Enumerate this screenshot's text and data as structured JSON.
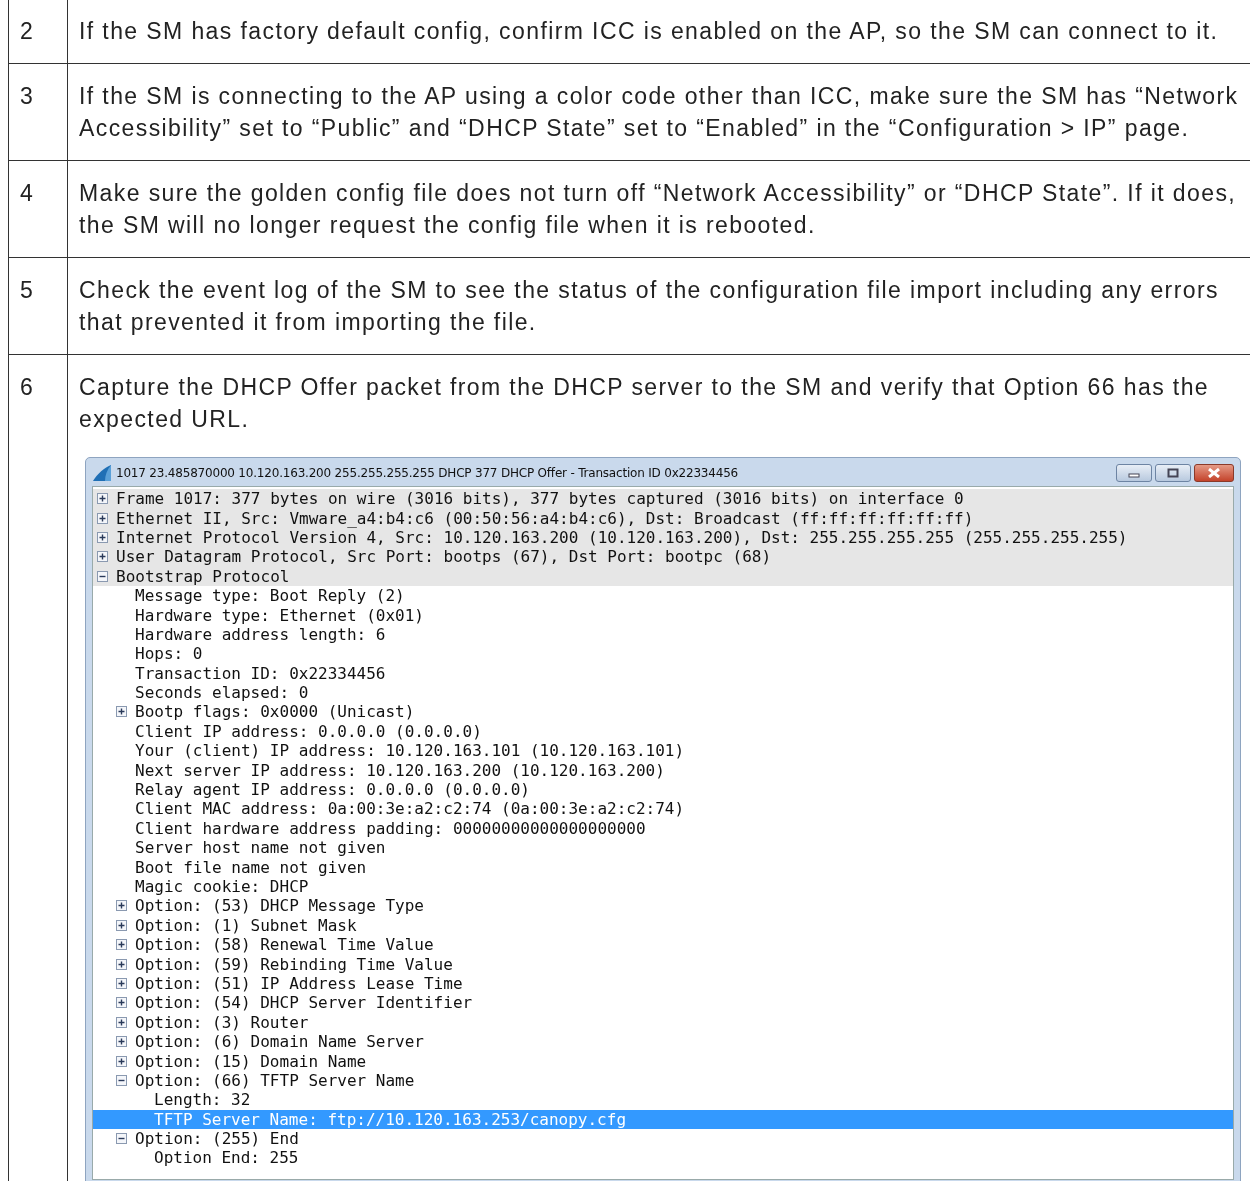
{
  "steps": [
    {
      "number": "2",
      "text": "If the SM has factory default config, confirm ICC is enabled on the AP, so the SM can connect to it."
    },
    {
      "number": "3",
      "text": "If the SM is connecting to the AP using a color code other than ICC, make sure the SM has “Network Accessibility” set to “Public” and “DHCP State” set to “Enabled” in the “Configuration > IP” page."
    },
    {
      "number": "4",
      "text": "Make sure the golden config file does not turn off “Network Accessibility” or “DHCP State”. If it does, the SM will no longer request the config file when it is rebooted."
    },
    {
      "number": "5",
      "text": "Check the event log of the SM to see the status of the configuration file import including any errors that prevented it from importing the file."
    },
    {
      "number": "6",
      "text": "Capture the DHCP Offer packet from the DHCP server to the SM and verify that Option 66 has the expected URL.",
      "screenshot": {
        "window": {
          "title": "1017 23.485870000 10.120.163.200 255.255.255.255 DHCP 377 DHCP Offer    - Transaction ID 0x22334456"
        },
        "tree": [
          {
            "kind": "branch",
            "expanded": false,
            "selected": false,
            "label": "Frame 1017: 377 bytes on wire (3016 bits), 377 bytes captured (3016 bits) on interface 0"
          },
          {
            "kind": "branch",
            "expanded": false,
            "selected": false,
            "label": "Ethernet II, Src: Vmware_a4:b4:c6 (00:50:56:a4:b4:c6), Dst: Broadcast (ff:ff:ff:ff:ff:ff)"
          },
          {
            "kind": "branch",
            "expanded": false,
            "selected": false,
            "label": "Internet Protocol Version 4, Src: 10.120.163.200 (10.120.163.200), Dst: 255.255.255.255 (255.255.255.255)"
          },
          {
            "kind": "branch",
            "expanded": false,
            "selected": false,
            "label": "User Datagram Protocol, Src Port: bootps (67), Dst Port: bootpc (68)"
          },
          {
            "kind": "branch",
            "expanded": true,
            "selected": false,
            "label": "Bootstrap Protocol",
            "children": [
              {
                "kind": "leaf",
                "selected": false,
                "label": "Message type: Boot Reply (2)"
              },
              {
                "kind": "leaf",
                "selected": false,
                "label": "Hardware type: Ethernet (0x01)"
              },
              {
                "kind": "leaf",
                "selected": false,
                "label": "Hardware address length: 6"
              },
              {
                "kind": "leaf",
                "selected": false,
                "label": "Hops: 0"
              },
              {
                "kind": "leaf",
                "selected": false,
                "label": "Transaction ID: 0x22334456"
              },
              {
                "kind": "leaf",
                "selected": false,
                "label": "Seconds elapsed: 0"
              },
              {
                "kind": "branch",
                "expanded": false,
                "selected": false,
                "label": "Bootp flags: 0x0000 (Unicast)"
              },
              {
                "kind": "leaf",
                "selected": false,
                "label": "Client IP address: 0.0.0.0 (0.0.0.0)"
              },
              {
                "kind": "leaf",
                "selected": false,
                "label": "Your (client) IP address: 10.120.163.101 (10.120.163.101)"
              },
              {
                "kind": "leaf",
                "selected": false,
                "label": "Next server IP address: 10.120.163.200 (10.120.163.200)"
              },
              {
                "kind": "leaf",
                "selected": false,
                "label": "Relay agent IP address: 0.0.0.0 (0.0.0.0)"
              },
              {
                "kind": "leaf",
                "selected": false,
                "label": "Client MAC address: 0a:00:3e:a2:c2:74 (0a:00:3e:a2:c2:74)"
              },
              {
                "kind": "leaf",
                "selected": false,
                "label": "Client hardware address padding: 00000000000000000000"
              },
              {
                "kind": "leaf",
                "selected": false,
                "label": "Server host name not given"
              },
              {
                "kind": "leaf",
                "selected": false,
                "label": "Boot file name not given"
              },
              {
                "kind": "leaf",
                "selected": false,
                "label": "Magic cookie: DHCP"
              },
              {
                "kind": "branch",
                "expanded": false,
                "selected": false,
                "label": "Option: (53) DHCP Message Type"
              },
              {
                "kind": "branch",
                "expanded": false,
                "selected": false,
                "label": "Option: (1) Subnet Mask"
              },
              {
                "kind": "branch",
                "expanded": false,
                "selected": false,
                "label": "Option: (58) Renewal Time Value"
              },
              {
                "kind": "branch",
                "expanded": false,
                "selected": false,
                "label": "Option: (59) Rebinding Time Value"
              },
              {
                "kind": "branch",
                "expanded": false,
                "selected": false,
                "label": "Option: (51) IP Address Lease Time"
              },
              {
                "kind": "branch",
                "expanded": false,
                "selected": false,
                "label": "Option: (54) DHCP Server Identifier"
              },
              {
                "kind": "branch",
                "expanded": false,
                "selected": false,
                "label": "Option: (3) Router"
              },
              {
                "kind": "branch",
                "expanded": false,
                "selected": false,
                "label": "Option: (6) Domain Name Server"
              },
              {
                "kind": "branch",
                "expanded": false,
                "selected": false,
                "label": "Option: (15) Domain Name"
              },
              {
                "kind": "branch",
                "expanded": true,
                "selected": false,
                "label": "Option: (66) TFTP Server Name",
                "children": [
                  {
                    "kind": "leaf",
                    "selected": false,
                    "label": "Length: 32"
                  },
                  {
                    "kind": "leaf",
                    "selected": true,
                    "label": "TFTP Server Name: ftp://10.120.163.253/canopy.cfg"
                  }
                ]
              },
              {
                "kind": "branch",
                "expanded": true,
                "selected": false,
                "label": "Option: (255) End",
                "children": [
                  {
                    "kind": "leaf",
                    "selected": false,
                    "label": "Option End: 255"
                  }
                ]
              }
            ]
          }
        ]
      }
    }
  ]
}
